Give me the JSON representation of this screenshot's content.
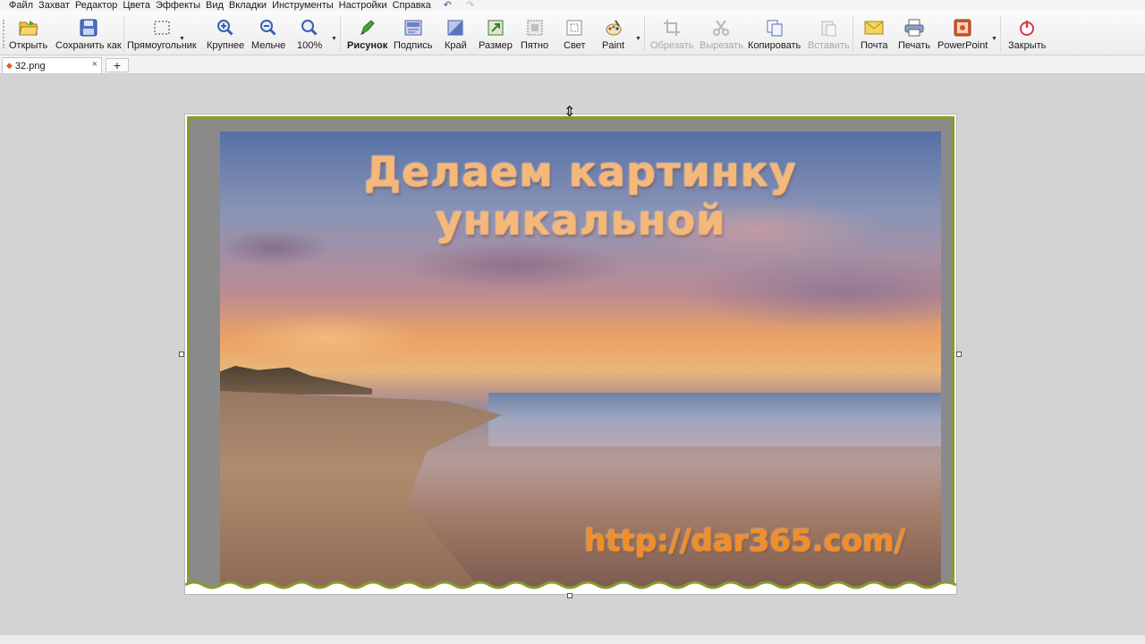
{
  "menu": {
    "items": [
      "Файл",
      "Захват",
      "Редактор",
      "Цвета",
      "Эффекты",
      "Вид",
      "Вкладки",
      "Инструменты",
      "Настройки",
      "Справка"
    ],
    "undo_icon": "undo-icon",
    "redo_icon": "redo-icon"
  },
  "toolbar": {
    "open": "Открыть",
    "save_as": "Сохранить как",
    "rectangular": "Прямоугольник",
    "zoom_in": "Крупнее",
    "zoom_out": "Мельче",
    "zoom_level": "100%",
    "drawing": "Рисунок",
    "caption": "Подпись",
    "edge": "Край",
    "size": "Размер",
    "spot": "Пятно",
    "light": "Свет",
    "paint": "Paint",
    "crop": "Обрезать",
    "cut": "Вырезать",
    "copy": "Копировать",
    "paste": "Вставить",
    "mail": "Почта",
    "print": "Печать",
    "powerpoint": "PowerPoint",
    "close": "Закрыть"
  },
  "tabs": {
    "active": "32.png",
    "close": "×",
    "add": "+"
  },
  "image": {
    "title": "Делаем картинку уникальной",
    "url": "http://dar365.com/"
  },
  "colors": {
    "accent_green": "#8a9a2a",
    "title_orange": "#f6b878",
    "url_orange": "#f28d28"
  }
}
